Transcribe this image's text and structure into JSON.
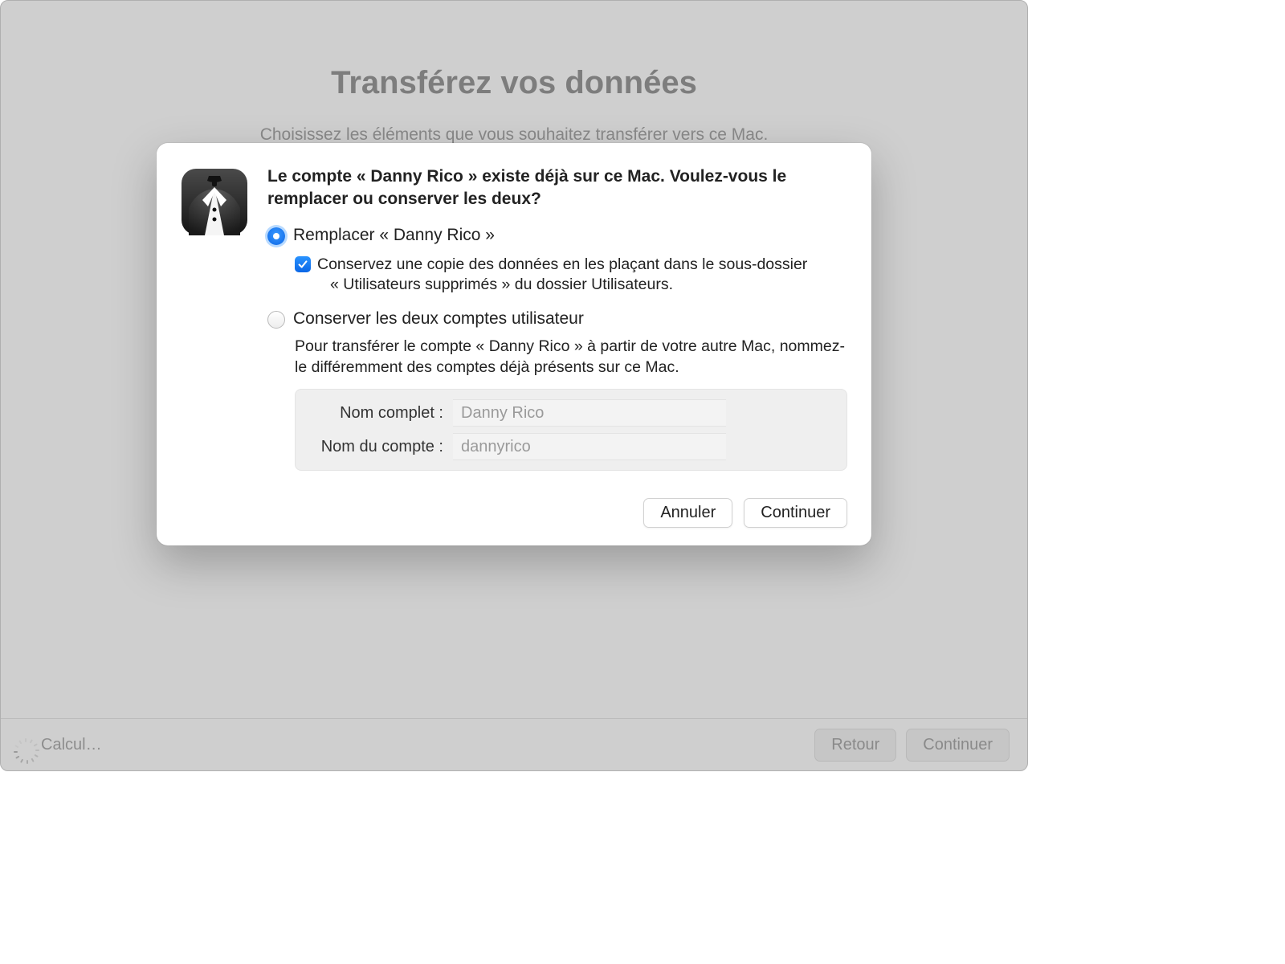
{
  "background": {
    "title": "Transférez vos données",
    "subtitle": "Choisissez les éléments que vous souhaitez transférer vers ce Mac."
  },
  "footer": {
    "status": "Calcul…",
    "back": "Retour",
    "continue": "Continuer"
  },
  "sheet": {
    "heading": "Le compte « Danny Rico » existe déjà sur ce Mac. Voulez-vous le remplacer ou conserver les deux?",
    "option_replace": "Remplacer « Danny Rico »",
    "option_replace_sub_line1": "Conservez une copie des données en les plaçant dans le sous-dossier",
    "option_replace_sub_line2": "« Utilisateurs supprimés » du dossier Utilisateurs.",
    "option_keep": "Conserver les deux comptes utilisateur",
    "option_keep_help": "Pour transférer le compte « Danny Rico » à partir de votre autre Mac, nommez-le différemment des comptes déjà présents sur ce Mac.",
    "fullname_label": "Nom complet :",
    "fullname_value": "Danny Rico",
    "accountname_label": "Nom du compte :",
    "accountname_value": "dannyrico",
    "cancel": "Annuler",
    "continue": "Continuer"
  }
}
